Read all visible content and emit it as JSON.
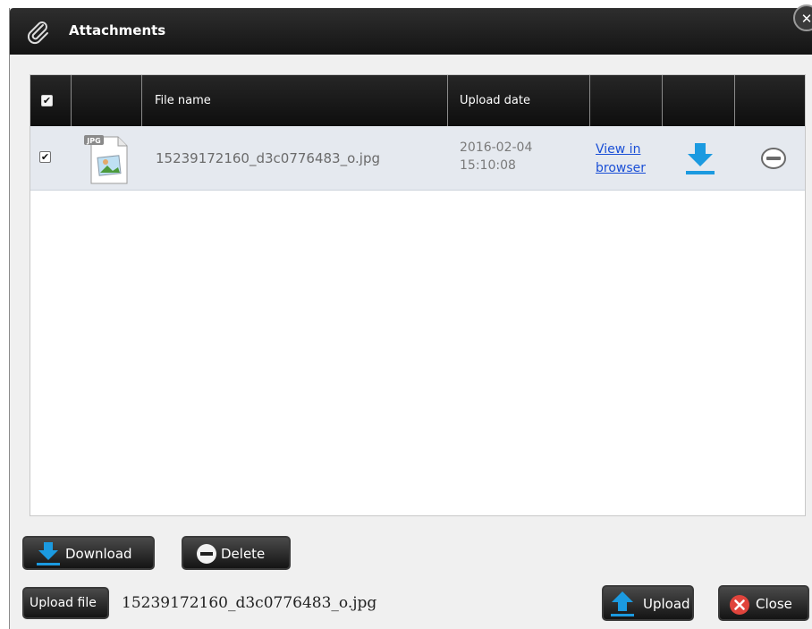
{
  "dialog": {
    "title": "Attachments",
    "close_symbol": "✕"
  },
  "grid": {
    "columns": {
      "select_all": "",
      "icon": "",
      "file_name": "File name",
      "upload_date": "Upload date",
      "view": "",
      "download": "",
      "delete": ""
    },
    "rows": [
      {
        "checked": true,
        "file_type": "JPG",
        "file_name": "15239172160_d3c0776483_o.jpg",
        "upload_date_line1": "2016-02-04",
        "upload_date_line2": "15:10:08",
        "view_link_line1": "View in",
        "view_link_line2": "browser"
      }
    ]
  },
  "footer": {
    "download_label": "Download",
    "delete_label": "Delete",
    "upload_file_label": "Upload file",
    "selected_file": "15239172160_d3c0776483_o.jpg",
    "upload_label": "Upload",
    "close_label": "Close"
  },
  "colors": {
    "accent_blue": "#1b9ae0",
    "link_blue": "#1a4fd6",
    "close_red": "#e0443c"
  },
  "icons": {
    "title": "paperclip-icon",
    "download": "download-arrow-icon",
    "delete": "minus-circle-icon",
    "file": "jpg-file-icon",
    "upload": "upload-arrow-icon",
    "close": "close-circle-icon"
  }
}
